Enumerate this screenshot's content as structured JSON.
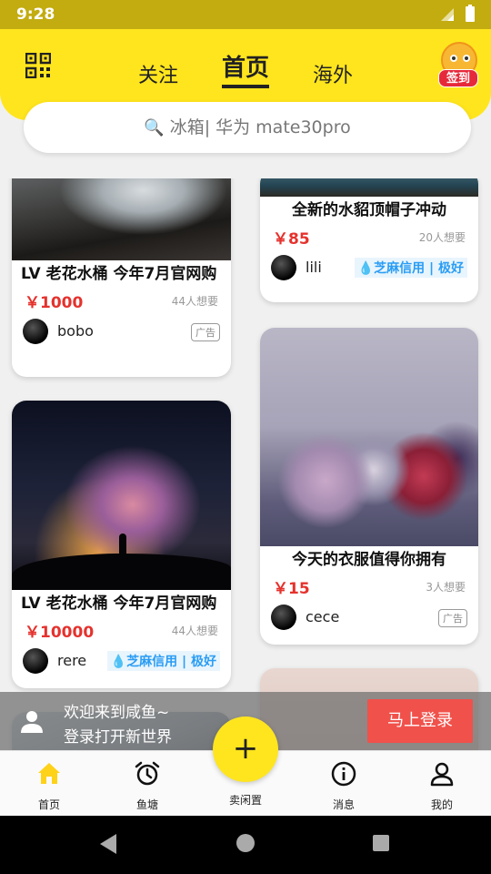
{
  "status": {
    "time": "9:28"
  },
  "header": {
    "tabs": [
      {
        "label": "关注",
        "active": false
      },
      {
        "label": "首页",
        "active": true
      },
      {
        "label": "海外",
        "active": false
      }
    ],
    "signin_label": "签到"
  },
  "search": {
    "placeholder": "冰箱| 华为 mate30pro"
  },
  "feed": {
    "left": [
      {
        "title": "LV 老花水桶 今年7月官网购",
        "price": "￥1000",
        "want": "44人想要",
        "user": "bobo",
        "tag": "广告",
        "tag_type": "ad"
      },
      {
        "title": "LV 老花水桶 今年7月官网购",
        "price": "￥10000",
        "want": "44人想要",
        "user": "rere",
        "tag": "芝麻信用 | 极好",
        "tag_type": "credit"
      }
    ],
    "right": [
      {
        "title": "全新的水貂顶帽子冲动",
        "price": "￥85",
        "want": "20人想要",
        "user": "lili",
        "tag": "芝麻信用 | 极好",
        "tag_type": "credit"
      },
      {
        "title": "今天的衣服值得你拥有",
        "price": "￥15",
        "want": "3人想要",
        "user": "cece",
        "tag": "广告",
        "tag_type": "ad"
      }
    ]
  },
  "login_banner": {
    "line1": "欢迎来到咸鱼~",
    "line2": "登录打开新世界",
    "button": "马上登录"
  },
  "bottom_nav": {
    "items": [
      {
        "label": "首页",
        "icon": "home-icon",
        "active": true
      },
      {
        "label": "鱼塘",
        "icon": "alarm-clock-icon",
        "active": false
      },
      {
        "label": "卖闲置",
        "icon": "plus-icon",
        "active": false
      },
      {
        "label": "消息",
        "icon": "info-icon",
        "active": false
      },
      {
        "label": "我的",
        "icon": "person-icon",
        "active": false
      }
    ]
  },
  "colors": {
    "accent_yellow": "#ffe51e",
    "price_red": "#e5322d",
    "login_button": "#f0514b",
    "credit_blue": "#2a9df4",
    "statusbar": "#c3ac10"
  }
}
